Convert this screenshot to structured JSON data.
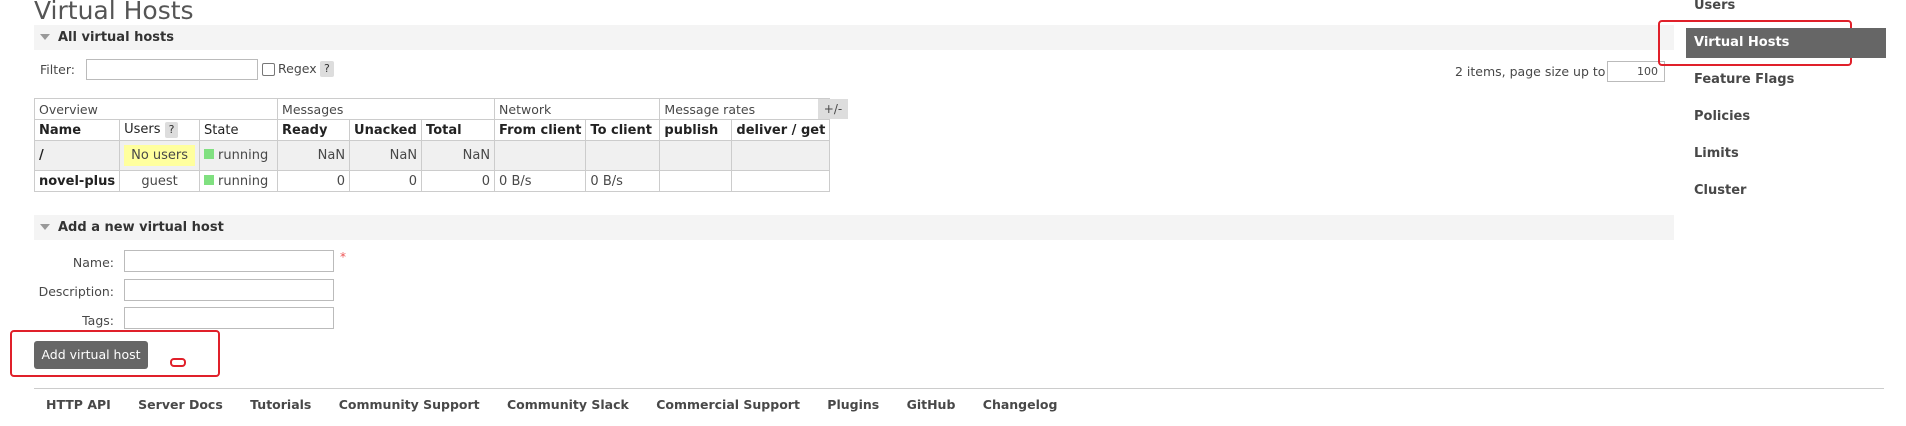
{
  "page": {
    "title": "Virtual Hosts"
  },
  "all_vhosts": {
    "heading": "All virtual hosts",
    "filter_label": "Filter:",
    "filter_value": "",
    "regex_label": "Regex",
    "help": "?",
    "page_size_label": "2 items, page size up to",
    "page_size_value": "100",
    "plus_minus": "+/-",
    "groups": [
      "Overview",
      "Messages",
      "Network",
      "Message rates"
    ],
    "columns": [
      "Name",
      "Users",
      "State",
      "Ready",
      "Unacked",
      "Total",
      "From client",
      "To client",
      "publish",
      "deliver / get"
    ],
    "rows": [
      {
        "name": "/",
        "users": "No users",
        "state": "running",
        "ready": "NaN",
        "unacked": "NaN",
        "total": "NaN",
        "from_client": "",
        "to_client": "",
        "publish": "",
        "deliver_get": ""
      },
      {
        "name": "novel-plus",
        "users": "guest",
        "state": "running",
        "ready": "0",
        "unacked": "0",
        "total": "0",
        "from_client": "0 B/s",
        "to_client": "0 B/s",
        "publish": "",
        "deliver_get": ""
      }
    ]
  },
  "add_vhost": {
    "heading": "Add a new virtual host",
    "name_label": "Name:",
    "name_value": "",
    "required_mark": "*",
    "description_label": "Description:",
    "description_value": "",
    "tags_label": "Tags:",
    "tags_value": "",
    "submit_label": "Add virtual host"
  },
  "nav": {
    "items": [
      "Users",
      "Virtual Hosts",
      "Feature Flags",
      "Policies",
      "Limits",
      "Cluster"
    ],
    "active": "Virtual Hosts"
  },
  "footer": {
    "links": [
      "HTTP API",
      "Server Docs",
      "Tutorials",
      "Community Support",
      "Community Slack",
      "Commercial Support",
      "Plugins",
      "GitHub",
      "Changelog"
    ]
  },
  "colors": {
    "highlight_box": "#e0202a",
    "running": "#80e080",
    "no_users_bg": "#ffff9e",
    "nav_active_bg": "#666666"
  }
}
